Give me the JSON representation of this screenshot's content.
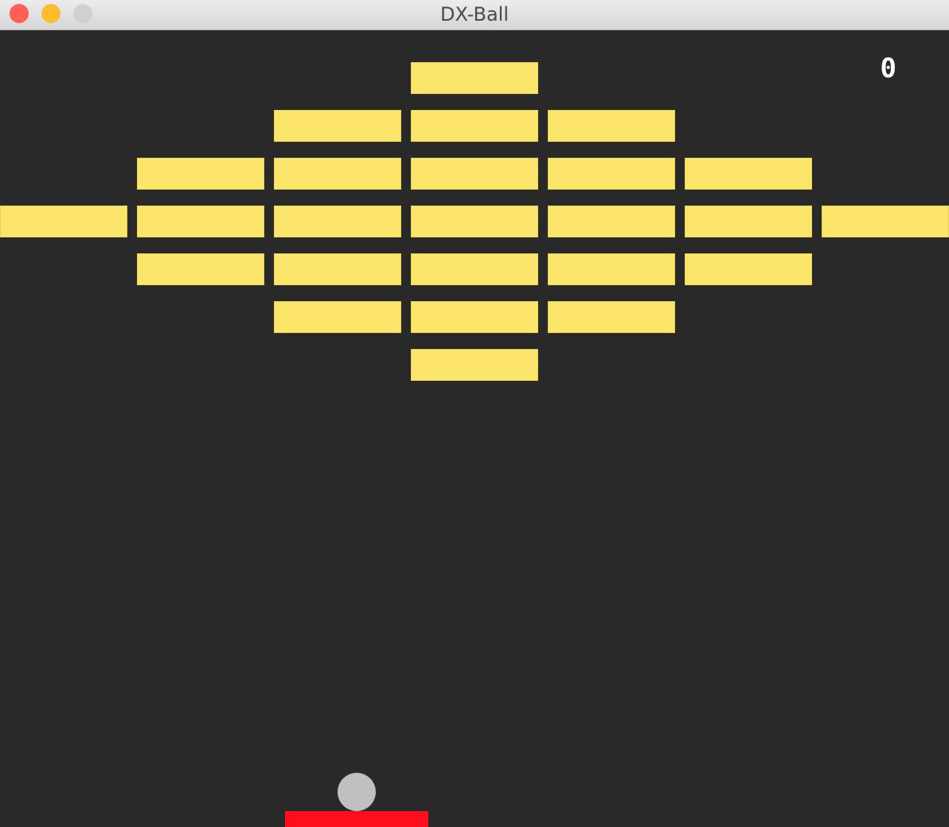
{
  "window": {
    "title": "DX-Ball",
    "controls": {
      "close_color": "#ff5f57",
      "minimize_color": "#febc2e",
      "zoom_color": "#d0d0d0"
    }
  },
  "game": {
    "score": "0",
    "colors": {
      "background": "#292929",
      "brick": "#fbe66b",
      "ball": "#c0c0c0",
      "paddle": "#ff0d1c"
    },
    "brick_layout": {
      "rows": [
        [
          3
        ],
        [
          2,
          3,
          4
        ],
        [
          1,
          2,
          3,
          4,
          5
        ],
        [
          0,
          1,
          2,
          3,
          4,
          5,
          6
        ],
        [
          1,
          2,
          3,
          4,
          5
        ],
        [
          2,
          3,
          4
        ],
        [
          3
        ]
      ]
    }
  }
}
